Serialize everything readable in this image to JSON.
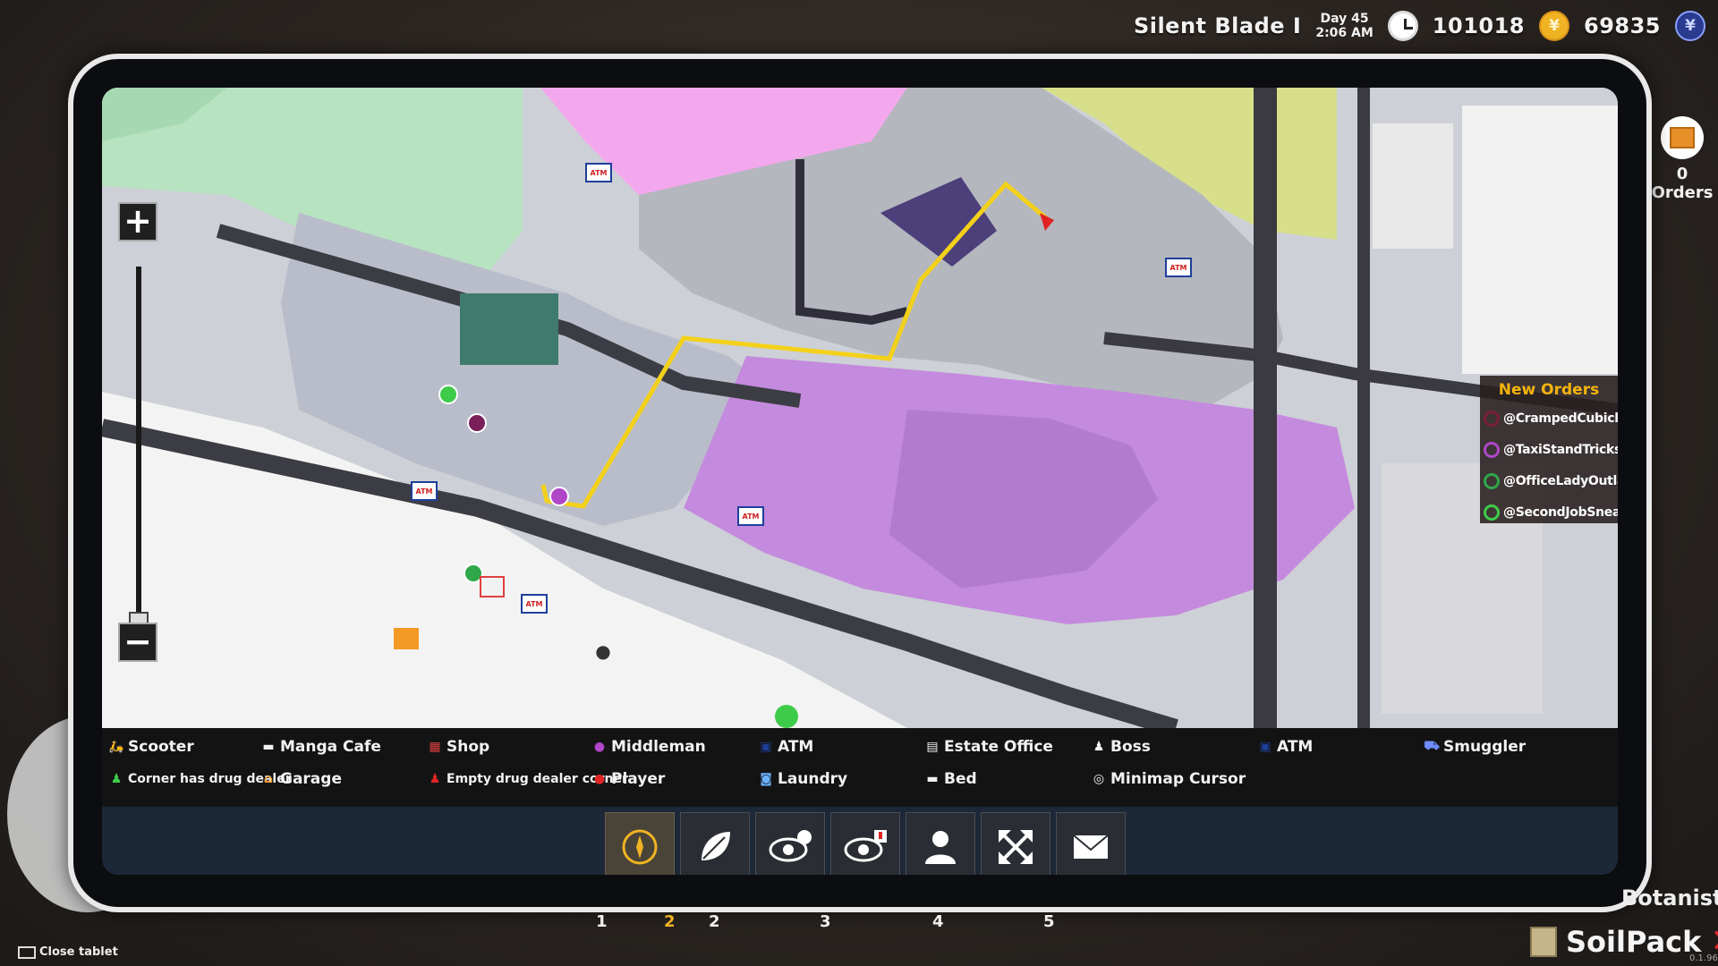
{
  "hud": {
    "player_name": "Silent Blade I",
    "day": "Day 45",
    "time": "2:06 AM",
    "cash": "101018",
    "coin_symbol": "¥",
    "tokens": "69835",
    "token_symbol": "¥"
  },
  "orders_side": {
    "label": "0 Orders"
  },
  "new_orders": {
    "title": "New Orders",
    "items": [
      {
        "name": "@CrampedCubicleConvict",
        "color": "#7a1f3a"
      },
      {
        "name": "@TaxiStandTrickster",
        "color": "#b046c8"
      },
      {
        "name": "@OfficeLadyOutlaw",
        "color": "#2fa84a"
      },
      {
        "name": "@SecondJobSneak",
        "color": "#3ecb4a"
      }
    ]
  },
  "map": {
    "zoom_in": "+",
    "zoom_out": "−",
    "atm_text": "ATM",
    "zone_colors": {
      "green": "#b7e3c0",
      "pink": "#f3a8ee",
      "purple": "#c48ade",
      "yellow": "#d8df8a",
      "route": "#f3d11a"
    }
  },
  "legend": {
    "scooter": "Scooter",
    "manga_cafe": "Manga Cafe",
    "shop": "Shop",
    "middleman": "Middleman",
    "atm1": "ATM",
    "estate_office": "Estate Office",
    "boss": "Boss",
    "atm2": "ATM",
    "smuggler": "Smuggler",
    "corner_dealer": "Corner has drug dealer",
    "garage": "Garage",
    "empty_corner": "Empty drug dealer corner",
    "player": "Player",
    "laundry": "Laundry",
    "bed": "Bed",
    "minimap_cursor": "Minimap Cursor"
  },
  "toolbar": {
    "buttons": [
      {
        "icon": "compass-icon"
      },
      {
        "icon": "leaf-icon"
      },
      {
        "icon": "eye-timer-icon"
      },
      {
        "icon": "eye-alert-icon"
      },
      {
        "icon": "person-icon"
      },
      {
        "icon": "expand-icon"
      },
      {
        "icon": "mail-icon"
      }
    ],
    "numbers": [
      "1",
      "2",
      "2",
      "3",
      "4",
      "5"
    ],
    "active_index": 0
  },
  "bottom": {
    "close_tablet": "Close tablet",
    "botanists": "Botanists",
    "item_name": "SoilPack",
    "version": "0.1.96"
  }
}
